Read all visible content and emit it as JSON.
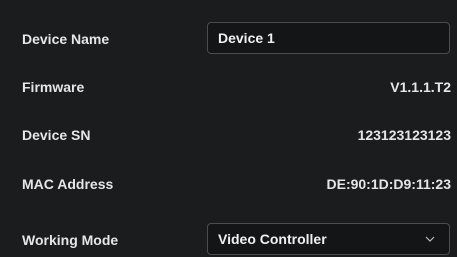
{
  "device_name": {
    "label": "Device Name",
    "value": "Device 1"
  },
  "firmware": {
    "label": "Firmware",
    "value": "V1.1.1.T2"
  },
  "device_sn": {
    "label": "Device SN",
    "value": "123123123123"
  },
  "mac_address": {
    "label": "MAC Address",
    "value": "DE:90:1D:D9:11:23"
  },
  "working_mode": {
    "label": "Working Mode",
    "selected": "Video Controller",
    "icon": "chevron-down-icon"
  },
  "colors": {
    "background": "#1b1c1e",
    "field_background": "#141517",
    "field_border": "#4a4c50",
    "text": "#e6e6e6"
  }
}
